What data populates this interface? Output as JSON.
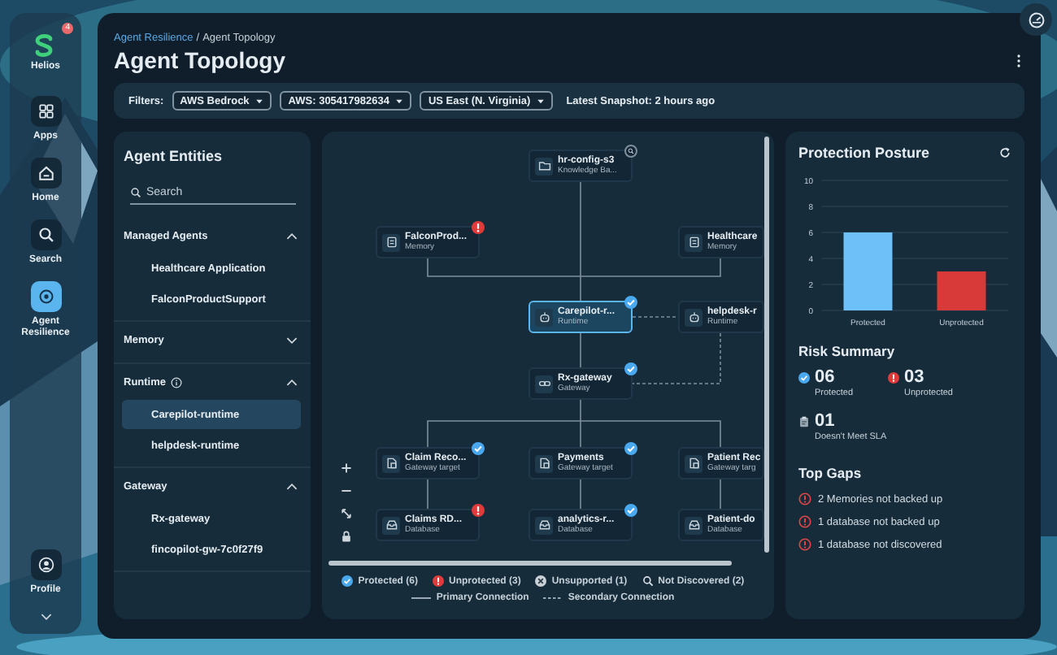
{
  "nav": {
    "brand": {
      "label": "Helios",
      "badge": "4"
    },
    "items": [
      {
        "label": "Apps",
        "kind": "apps",
        "selected": false
      },
      {
        "label": "Home",
        "kind": "home",
        "selected": false
      },
      {
        "label": "Search",
        "kind": "search",
        "selected": false
      },
      {
        "label": "Agent Resilience",
        "kind": "resilience",
        "selected": true
      }
    ],
    "profile": {
      "label": "Profile"
    }
  },
  "breadcrumb": {
    "parent": "Agent Resilience",
    "separator": "/",
    "current": "Agent Topology"
  },
  "title": "Agent Topology",
  "filters": {
    "label": "Filters:",
    "chips": [
      "AWS Bedrock",
      "AWS: 305417982634",
      "US East (N. Virginia)"
    ],
    "snapshot": "Latest Snapshot: 2 hours ago"
  },
  "entities": {
    "title": "Agent Entities",
    "search": {
      "placeholder": "Search"
    },
    "sections": [
      {
        "label": "Managed Agents",
        "info": false,
        "expanded": true,
        "items": [
          {
            "label": "Healthcare Application",
            "selected": false
          },
          {
            "label": "FalconProductSupport",
            "selected": false
          }
        ]
      },
      {
        "label": "Memory",
        "info": false,
        "expanded": false
      },
      {
        "label": "Runtime",
        "info": true,
        "expanded": true,
        "items": [
          {
            "label": "Carepilot-runtime",
            "selected": true
          },
          {
            "label": "helpdesk-runtime",
            "selected": false
          }
        ]
      },
      {
        "label": "Gateway",
        "info": false,
        "expanded": true,
        "items": [
          {
            "label": "Rx-gateway",
            "selected": false
          },
          {
            "label": "fincopilot-gw-7c0f27f9",
            "selected": false
          }
        ]
      }
    ]
  },
  "topology": {
    "nodes": [
      {
        "name": "hr-config-s3",
        "type": "Knowledge Ba...",
        "kind": "knowledge",
        "badge": {
          "kind": "search"
        },
        "selected": false
      },
      {
        "name": "FalconProd...",
        "type": "Memory",
        "kind": "memory",
        "badge": {
          "kind": "alert"
        },
        "selected": false
      },
      {
        "name": "Healthcare",
        "type": "Memory",
        "kind": "memory",
        "selected": false
      },
      {
        "name": "Carepilot-r...",
        "type": "Runtime",
        "kind": "runtime",
        "badge": {
          "kind": "check"
        },
        "selected": true
      },
      {
        "name": "helpdesk-r",
        "type": "Runtime",
        "kind": "runtime",
        "selected": false
      },
      {
        "name": "Rx-gateway",
        "type": "Gateway",
        "kind": "gateway",
        "badge": {
          "kind": "check"
        },
        "selected": false
      },
      {
        "name": "Claim Reco...",
        "type": "Gateway target",
        "kind": "target",
        "badge": {
          "kind": "check"
        },
        "selected": false
      },
      {
        "name": "Payments",
        "type": "Gateway target",
        "kind": "target",
        "badge": {
          "kind": "check"
        },
        "selected": false
      },
      {
        "name": "Patient Rec",
        "type": "Gateway targ",
        "kind": "target",
        "selected": false
      },
      {
        "name": "Claims RD...",
        "type": "Database",
        "kind": "database",
        "badge": {
          "kind": "alert"
        },
        "selected": false
      },
      {
        "name": "analytics-r...",
        "type": "Database",
        "kind": "database",
        "badge": {
          "kind": "check"
        },
        "selected": false
      },
      {
        "name": "Patient-do",
        "type": "Database",
        "kind": "database",
        "selected": false
      }
    ],
    "legend": {
      "statuses": [
        {
          "label": "Protected (6)",
          "kind": "check"
        },
        {
          "label": "Unprotected (3)",
          "kind": "alert"
        },
        {
          "label": "Unsupported (1)",
          "kind": "cross"
        },
        {
          "label": "Not Discovered (2)",
          "kind": "search"
        }
      ],
      "connections": [
        {
          "label": "Primary Connection",
          "kind": "solid"
        },
        {
          "label": "Secondary Connection",
          "kind": "dashed"
        }
      ]
    }
  },
  "posture": {
    "title": "Protection Posture",
    "chart_data": {
      "type": "bar",
      "categories": [
        "Protected",
        "Unprotected"
      ],
      "stacked": true,
      "grid": true,
      "ylim": [
        0,
        10
      ],
      "yticks": [
        0,
        2,
        4,
        6,
        8,
        10
      ],
      "series": [
        {
          "color": "#6ec0f8",
          "values": [
            6,
            null
          ]
        },
        {
          "color": "#d83a3a",
          "values": [
            null,
            3
          ]
        }
      ]
    }
  },
  "risk": {
    "title": "Risk Summary",
    "items": [
      {
        "value": "06",
        "label": "Protected",
        "kind": "check"
      },
      {
        "value": "03",
        "label": "Unprotected",
        "kind": "alert"
      },
      {
        "value": "01",
        "label": "Doesn't Meet SLA",
        "kind": "clipboard"
      }
    ]
  },
  "gaps": {
    "title": "Top Gaps",
    "items": [
      "2 Memories not backed up",
      "1 database not backed up",
      "1 database not discovered"
    ]
  }
}
